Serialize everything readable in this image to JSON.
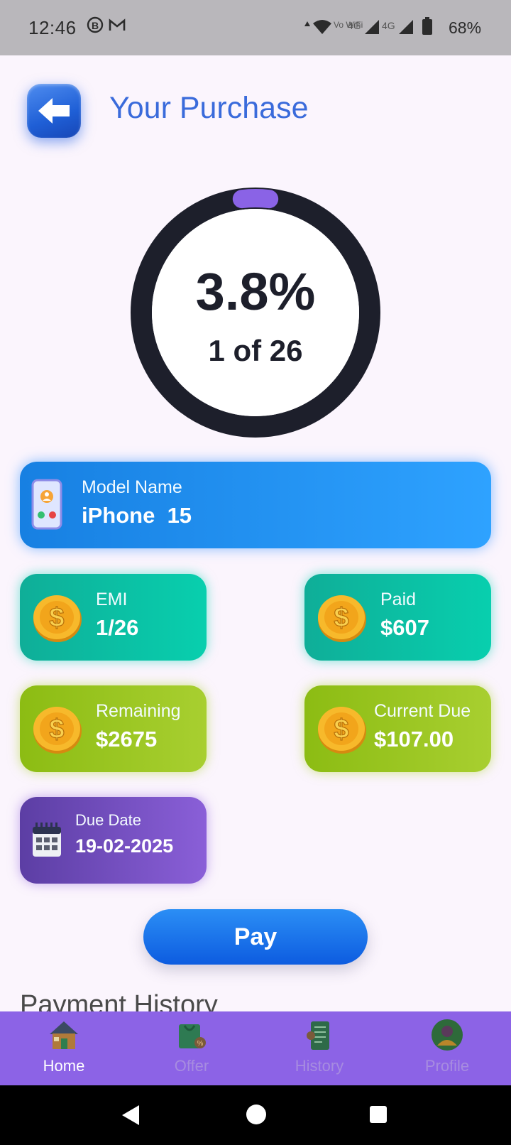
{
  "status_bar": {
    "time": "12:46",
    "notification_icons": [
      "b-icon",
      "gmail-icon"
    ],
    "network_labels": [
      "Vo WiFi",
      "4G",
      "4G"
    ],
    "battery": "68%"
  },
  "header": {
    "title": "Your Purchase"
  },
  "progress": {
    "percent_text": "3.8%",
    "count_text": "1 of 26",
    "fraction": 0.038
  },
  "model": {
    "label": "Model Name",
    "value": "iPhone  15"
  },
  "cards": {
    "emi": {
      "label": "EMI",
      "value": "1/26"
    },
    "paid": {
      "label": "Paid",
      "value": "$607"
    },
    "remaining": {
      "label": "Remaining",
      "value": "$2675"
    },
    "current_due": {
      "label": "Current Due",
      "value": "$107.00"
    },
    "due_date": {
      "label": "Due Date",
      "value": "19-02-2025"
    }
  },
  "pay_button": "Pay",
  "payment_history_title": "Payment History",
  "bottom_nav": {
    "items": [
      {
        "label": "Home",
        "icon": "home-icon",
        "active": true
      },
      {
        "label": "Offer",
        "icon": "offer-icon",
        "active": false
      },
      {
        "label": "History",
        "icon": "history-icon",
        "active": false
      },
      {
        "label": "Profile",
        "icon": "profile-icon",
        "active": false
      }
    ]
  },
  "colors": {
    "accent": "#3a6bdb",
    "ring_dark": "#1d1f2b",
    "ring_progress": "#8a63e6",
    "nav_bg": "#8c63e6"
  }
}
